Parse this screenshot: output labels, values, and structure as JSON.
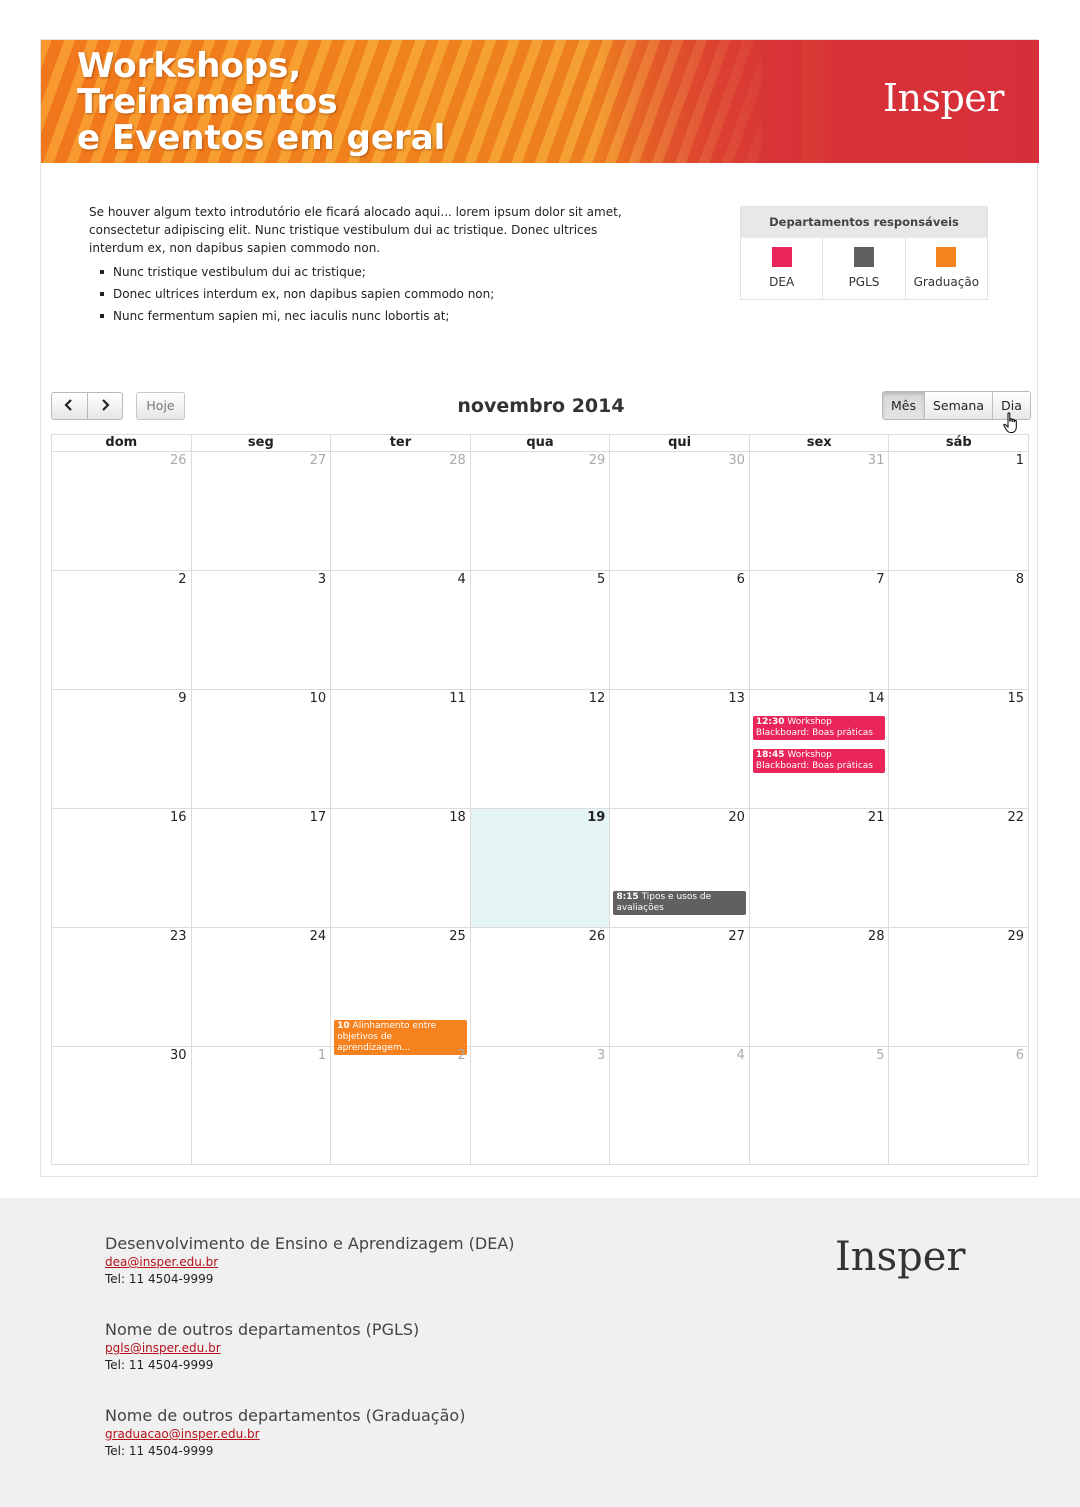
{
  "banner": {
    "title_lines": [
      "Workshops,",
      "Treinamentos",
      "e Eventos em geral"
    ],
    "logo": "Insper"
  },
  "intro": {
    "paragraph": "Se houver algum texto introdutório ele ficará alocado aqui... lorem ipsum dolor sit amet, consectetur adipiscing elit. Nunc tristique vestibulum dui ac tristique. Donec ultrices interdum ex, non dapibus sapien commodo non.",
    "bullets": [
      "Nunc tristique vestibulum dui ac tristique;",
      "Donec ultrices interdum ex, non dapibus sapien commodo non;",
      "Nunc fermentum sapien mi, nec iaculis nunc lobortis at;"
    ]
  },
  "legend": {
    "title": "Departamentos responsáveis",
    "items": [
      {
        "label": "DEA",
        "color": "#e9255a"
      },
      {
        "label": "PGLS",
        "color": "#606060"
      },
      {
        "label": "Graduação",
        "color": "#f5821f"
      }
    ]
  },
  "toolbar": {
    "prev_icon": "chevron-left-icon",
    "next_icon": "chevron-right-icon",
    "today_label": "Hoje",
    "month_title": "novembro 2014",
    "views": [
      "Mês",
      "Semana",
      "Dia"
    ],
    "active_view": "Mês"
  },
  "calendar": {
    "weekdays": [
      "dom",
      "seg",
      "ter",
      "qua",
      "qui",
      "sex",
      "sáb"
    ],
    "weeks": [
      [
        "26",
        "27",
        "28",
        "29",
        "30",
        "31",
        "1"
      ],
      [
        "2",
        "3",
        "4",
        "5",
        "6",
        "7",
        "8"
      ],
      [
        "9",
        "10",
        "11",
        "12",
        "13",
        "14",
        "15"
      ],
      [
        "16",
        "17",
        "18",
        "19",
        "20",
        "21",
        "22"
      ],
      [
        "23",
        "24",
        "25",
        "26",
        "27",
        "28",
        "29"
      ],
      [
        "30",
        "1",
        "2",
        "3",
        "4",
        "5",
        "6"
      ]
    ],
    "today": "19",
    "events": [
      {
        "day": "14",
        "time": "12:30",
        "title": "Workshop Blackboard: Boas práticas",
        "color": "#e9255a"
      },
      {
        "day": "14",
        "time": "18:45",
        "title": "Workshop Blackboard: Boas práticas",
        "color": "#e9255a"
      },
      {
        "day": "20",
        "time": "8:15",
        "title": "Tipos e usos de avaliações",
        "color": "#606060"
      },
      {
        "day": "25",
        "time": "10",
        "title": "Alinhamento entre objetivos de aprendizagem...",
        "color": "#f5821f"
      }
    ]
  },
  "footer": {
    "logo": "Insper",
    "departments": [
      {
        "name": "Desenvolvimento de Ensino e Aprendizagem (DEA)",
        "email": "dea@insper.edu.br",
        "tel": "Tel: 11 4504-9999"
      },
      {
        "name": "Nome de outros departamentos (PGLS)",
        "email": "pgls@insper.edu.br",
        "tel": "Tel: 11 4504-9999"
      },
      {
        "name": "Nome de outros departamentos (Graduação)",
        "email": "graduacao@insper.edu.br",
        "tel": "Tel: 11 4504-9999"
      }
    ]
  }
}
